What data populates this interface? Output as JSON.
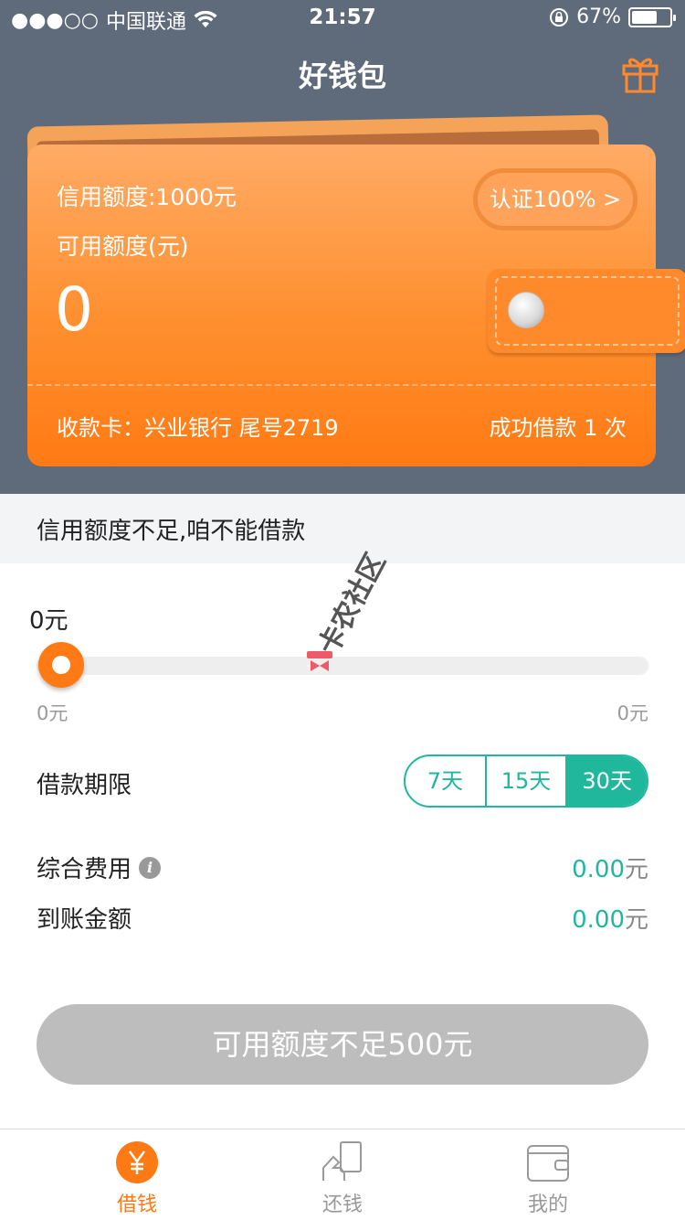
{
  "status_bar": {
    "signal": "●●●○○",
    "carrier": "中国联通",
    "time": "21:57",
    "battery": "67%",
    "battery_level": 0.67
  },
  "header": {
    "title": "好钱包"
  },
  "wallet": {
    "credit_limit": "信用额度:1000元",
    "available_label": "可用额度(元)",
    "available_value": "0",
    "auth_badge": "认证100% >",
    "card_info": "收款卡：兴业银行 尾号2719",
    "loan_count": "成功借款 1 次"
  },
  "notice": {
    "text": "信用额度不足,咱不能借款"
  },
  "loan": {
    "amount": "0元",
    "slider_min": "0元",
    "slider_max": "0元",
    "slider_level": 0,
    "term_label": "借款期限",
    "term_options": [
      "7天",
      "15天",
      "30天"
    ],
    "term_selected": "30天"
  },
  "fees": {
    "service_label": "综合费用",
    "service_value": "0.00",
    "service_unit": "元",
    "received_label": "到账金额",
    "received_value": "0.00",
    "received_unit": "元"
  },
  "button": {
    "label": "可用额度不足500元"
  },
  "watermark": {
    "text": "卡农社区"
  },
  "tabbar": {
    "items": [
      {
        "label": "借钱",
        "icon": "yuan-icon",
        "active": true
      },
      {
        "label": "还钱",
        "icon": "repay-icon",
        "active": false
      },
      {
        "label": "我的",
        "icon": "wallet-icon",
        "active": false
      }
    ]
  },
  "colors": {
    "accent": "#ff7a14",
    "teal": "#1fb89d",
    "header_bg": "#5f6b7b"
  }
}
